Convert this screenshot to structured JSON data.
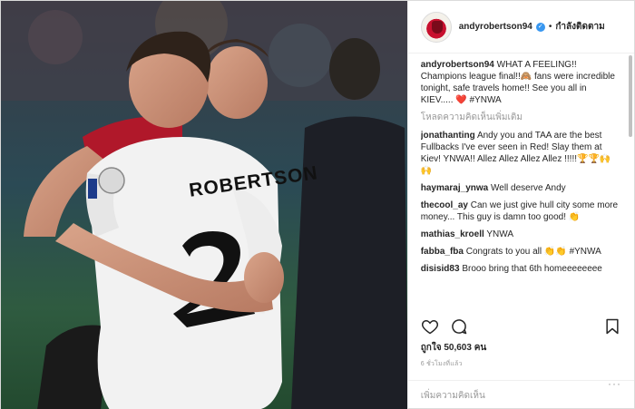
{
  "post": {
    "username": "andyrobertson94",
    "follow_label": "กำลังติดตาม",
    "jersey_text": "ROBERTSON"
  },
  "caption": {
    "username": "andyrobertson94",
    "text": "WHAT A FEELING!! Champions league final!!🙈 fans were incredible tonight, safe travels home!! See you all in KIEV..... ❤️ #YNWA"
  },
  "load_more_label": "โหลดความคิดเห็นเพิ่มเติม",
  "comments": [
    {
      "username": "jonathanting",
      "text": "Andy you and TAA are the best Fullbacks I've ever seen in Red! Slay them at Kiev! YNWA!! Allez Allez Allez Allez !!!!!🏆🏆🙌🙌"
    },
    {
      "username": "haymaraj_ynwa",
      "text": "Well deserve Andy"
    },
    {
      "username": "thecool_ay",
      "text": "Can we just give hull city some more money... This guy is damn too good! 👏"
    },
    {
      "username": "mathias_kroell",
      "text": "YNWA"
    },
    {
      "username": "fabba_fba",
      "text": "Congrats to you all 👏👏 #YNWA"
    },
    {
      "username": "disisid83",
      "text": "Brooo bring that 6th homeeeeeeee"
    }
  ],
  "icons": {
    "like": "heart-icon",
    "comment": "comment-icon",
    "save": "bookmark-icon",
    "verified": "verified-badge-icon",
    "more": "more-dots-icon"
  },
  "likes_text": "ถูกใจ 50,603 คน",
  "timestamp": "6 ชั่วโมงที่แล้ว",
  "add_comment_placeholder": "เพิ่มความคิดเห็น",
  "more_label": "···",
  "colors": {
    "accent_blue": "#3897f0",
    "liverpool_red": "#c8102e",
    "muted_text": "#999999"
  }
}
